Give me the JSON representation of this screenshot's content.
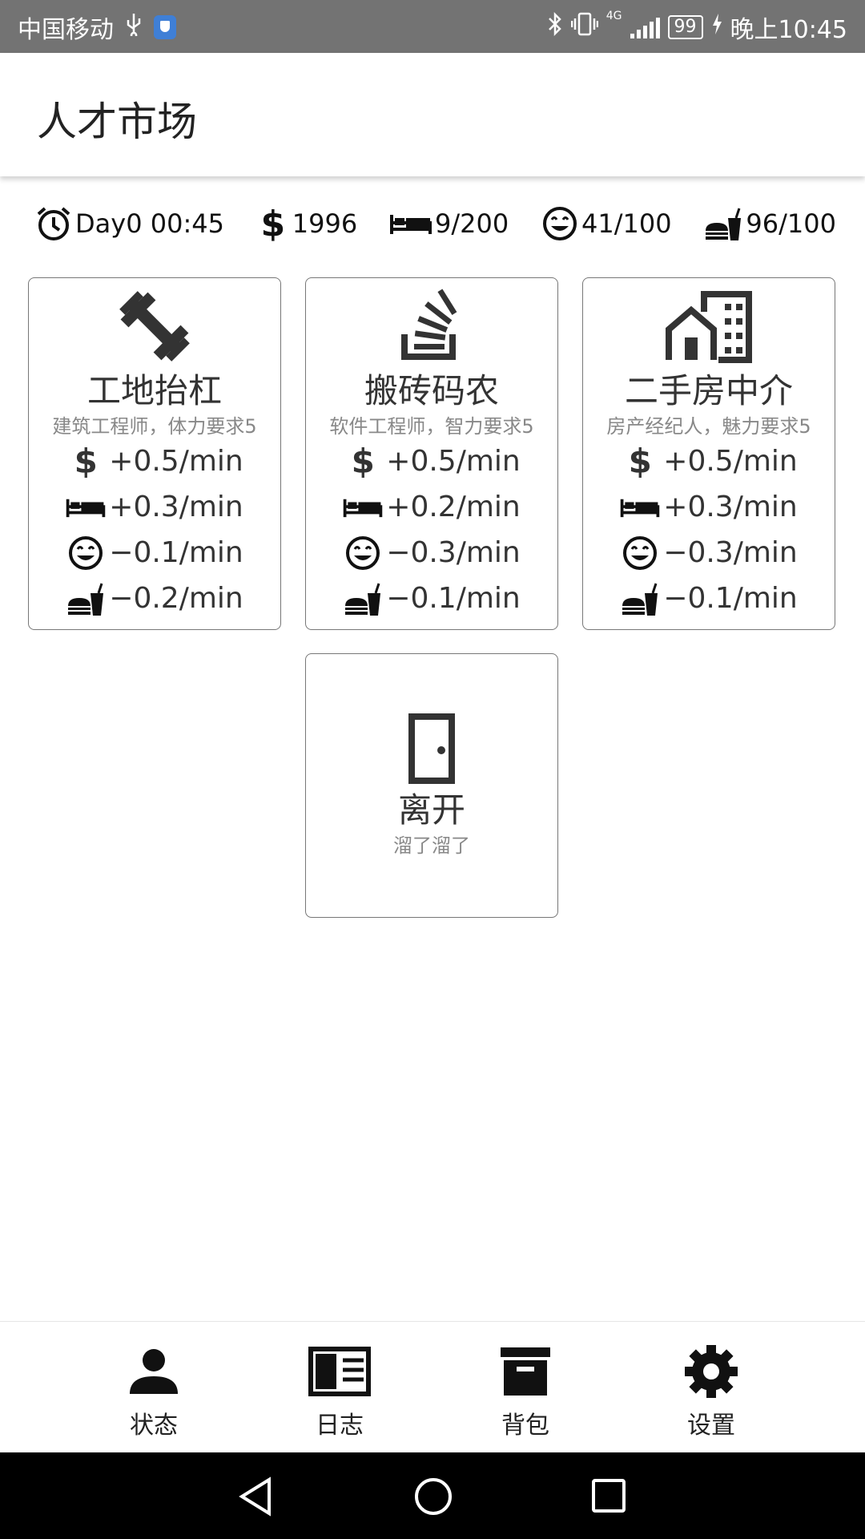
{
  "status_bar": {
    "carrier": "中国移动",
    "network": "4G",
    "battery": "99",
    "time": "晚上10:45"
  },
  "app_bar": {
    "title": "人才市场"
  },
  "stats": {
    "time": "Day0 00:45",
    "money": "1996",
    "energy": "9/200",
    "mood": "41/100",
    "food": "96/100"
  },
  "jobs": [
    {
      "icon": "dumbbell-icon",
      "title": "工地抬杠",
      "subtitle": "建筑工程师，体力要求5",
      "money_rate": "+0.5/min",
      "energy_rate": "+0.3/min",
      "mood_rate": "−0.1/min",
      "food_rate": "−0.2/min"
    },
    {
      "icon": "stack-overflow-icon",
      "title": "搬砖码农",
      "subtitle": "软件工程师，智力要求5",
      "money_rate": "+0.5/min",
      "energy_rate": "+0.2/min",
      "mood_rate": "−0.3/min",
      "food_rate": "−0.1/min"
    },
    {
      "icon": "house-building-icon",
      "title": "二手房中介",
      "subtitle": "房产经纪人，魅力要求5",
      "money_rate": "+0.5/min",
      "energy_rate": "+0.3/min",
      "mood_rate": "−0.3/min",
      "food_rate": "−0.1/min"
    }
  ],
  "leave": {
    "title": "离开",
    "subtitle": "溜了溜了"
  },
  "bottom_nav": [
    {
      "label": "状态",
      "icon": "person-icon"
    },
    {
      "label": "日志",
      "icon": "book-icon"
    },
    {
      "label": "背包",
      "icon": "archive-icon"
    },
    {
      "label": "设置",
      "icon": "gear-icon"
    }
  ]
}
